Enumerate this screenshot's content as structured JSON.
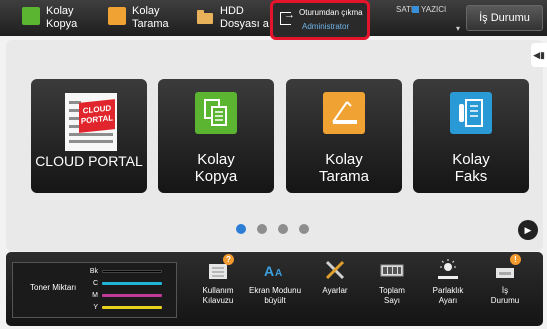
{
  "topbar": {
    "kolay_kopya": "Kolay\nKopya",
    "kolay_tarama": "Kolay\nTarama",
    "hdd": "HDD\nDosyası a",
    "logout_label": "Oturumdan çıkma",
    "logout_user": "Administrator",
    "status_satir": "SATIR",
    "status_yazici": "YAZICI",
    "jobs_label": "İş Durumu"
  },
  "tiles": {
    "cloud_portal": {
      "label": "CLOUD PORTAL",
      "logo_text": "CLOUD\nPORTAL"
    },
    "kolay_kopya": {
      "label": "Kolay\nKopya"
    },
    "kolay_tarama": {
      "label": "Kolay\nTarama"
    },
    "kolay_faks": {
      "label": "Kolay\nFaks"
    }
  },
  "pagination": {
    "pages": 4,
    "active": 1
  },
  "toner": {
    "label": "Toner Miktarı",
    "rows": [
      {
        "key": "Bk",
        "color": "#000000"
      },
      {
        "key": "C",
        "color": "#1fb6d6"
      },
      {
        "key": "M",
        "color": "#c0389a"
      },
      {
        "key": "Y",
        "color": "#e8d21c"
      }
    ]
  },
  "tools": {
    "guide": "Kullanım\nKılavuzu",
    "zoom": "Ekran Modunu\nbüyült",
    "settings": "Ayarlar",
    "total": "Toplam\nSayı",
    "brightness": "Parlaklık\nAyarı",
    "jobs": "İş\nDurumu"
  },
  "colors": {
    "accent_blue": "#2c7dd6",
    "highlight_red": "#e3142b",
    "badge_orange": "#f29a2e"
  }
}
